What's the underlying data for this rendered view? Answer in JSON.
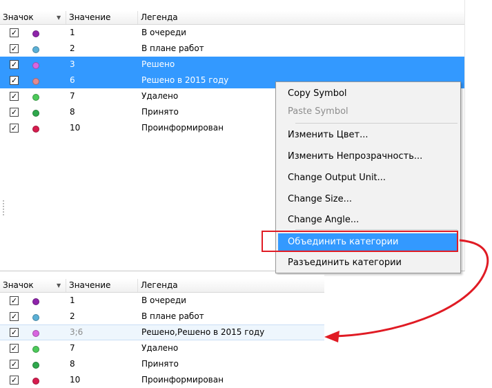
{
  "columns": {
    "symbol": "Значок",
    "value": "Значение",
    "legend": "Легенда"
  },
  "top_table": {
    "rows": [
      {
        "value": "1",
        "legend": "В очереди",
        "color": "#8e24aa",
        "selected": false
      },
      {
        "value": "2",
        "legend": "В плане работ",
        "color": "#5bb0d6",
        "selected": false
      },
      {
        "value": "3",
        "legend": "Решено",
        "color": "#d866e0",
        "selected": true
      },
      {
        "value": "6",
        "legend": "Решено в 2015 году",
        "color": "#e08a90",
        "selected": true
      },
      {
        "value": "7",
        "legend": "Удалено",
        "color": "#4cc95a",
        "selected": false
      },
      {
        "value": "8",
        "legend": "Принято",
        "color": "#2ea84c",
        "selected": false
      },
      {
        "value": "10",
        "legend": "Проинформирован",
        "color": "#d61c4e",
        "selected": false
      }
    ]
  },
  "context_menu": {
    "items": [
      {
        "label": "Copy Symbol",
        "enabled": true
      },
      {
        "label": "Paste Symbol",
        "enabled": false
      },
      {
        "label": "Изменить Цвет...",
        "enabled": true
      },
      {
        "label": "Изменить Непрозрачность...",
        "enabled": true
      },
      {
        "label": "Change Output Unit...",
        "enabled": true
      },
      {
        "label": "Change Size...",
        "enabled": true
      },
      {
        "label": "Change Angle...",
        "enabled": true
      },
      {
        "label": "Объединить категории",
        "enabled": true,
        "highlighted": true
      },
      {
        "label": "Разъединить категории",
        "enabled": true
      }
    ]
  },
  "bottom_table": {
    "rows": [
      {
        "value": "1",
        "legend": "В очереди",
        "color": "#8e24aa"
      },
      {
        "value": "2",
        "legend": "В плане работ",
        "color": "#5bb0d6"
      },
      {
        "value": "3;6",
        "legend": "Решено,Решено в 2015 году",
        "color": "#d866e0",
        "merged": true
      },
      {
        "value": "7",
        "legend": "Удалено",
        "color": "#4cc95a"
      },
      {
        "value": "8",
        "legend": "Принято",
        "color": "#2ea84c"
      },
      {
        "value": "10",
        "legend": "Проинформирован",
        "color": "#d61c4e"
      }
    ]
  },
  "colors": {
    "selection": "#3399ff",
    "annotation": "#e01b24",
    "merged_row": "#eef6fd"
  },
  "icons": {
    "checkbox": "check-icon",
    "sort": "sort-down-icon"
  }
}
